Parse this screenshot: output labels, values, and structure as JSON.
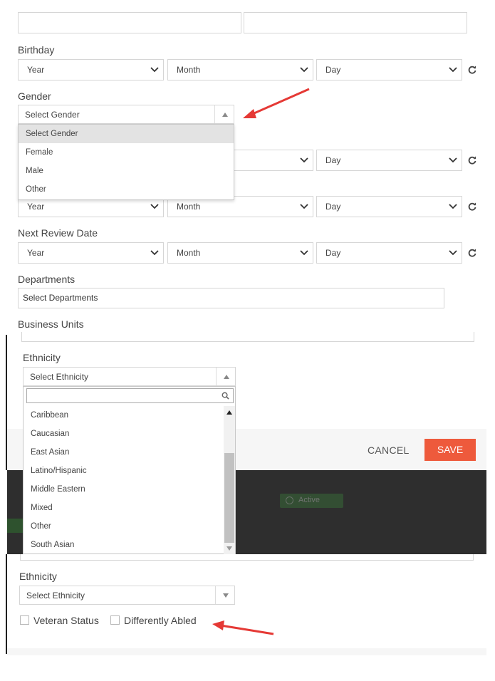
{
  "birthday": {
    "label": "Birthday",
    "year": "Year",
    "month": "Month",
    "day": "Day"
  },
  "gender": {
    "label": "Gender",
    "selected": "Select Gender",
    "options": [
      "Select Gender",
      "Female",
      "Male",
      "Other"
    ]
  },
  "date_row_3": {
    "day": "Day"
  },
  "date_row_4": {
    "year": "Year",
    "month": "Month",
    "day": "Day"
  },
  "next_review": {
    "label": "Next Review Date",
    "year": "Year",
    "month": "Month",
    "day": "Day"
  },
  "departments": {
    "label": "Departments",
    "placeholder": "Select Departments"
  },
  "business_units": {
    "label": "Business Units"
  },
  "ethnicity_open": {
    "label": "Ethnicity",
    "selected": "Select Ethnicity",
    "options": [
      "Caribbean",
      "Caucasian",
      "East Asian",
      "Latino/Hispanic",
      "Middle Eastern",
      "Mixed",
      "Other",
      "South Asian"
    ]
  },
  "footer": {
    "cancel": "CANCEL",
    "save": "SAVE"
  },
  "status_badge": "Active",
  "ethnicity_closed": {
    "label": "Ethnicity",
    "selected": "Select Ethnicity"
  },
  "checkboxes": {
    "veteran": "Veteran Status",
    "differently_abled": "Differently Abled"
  },
  "colors": {
    "save": "#ee5a3c",
    "arrow": "#e53935",
    "dark_band": "#2e2e2e",
    "badge": "#3f8a3f"
  }
}
